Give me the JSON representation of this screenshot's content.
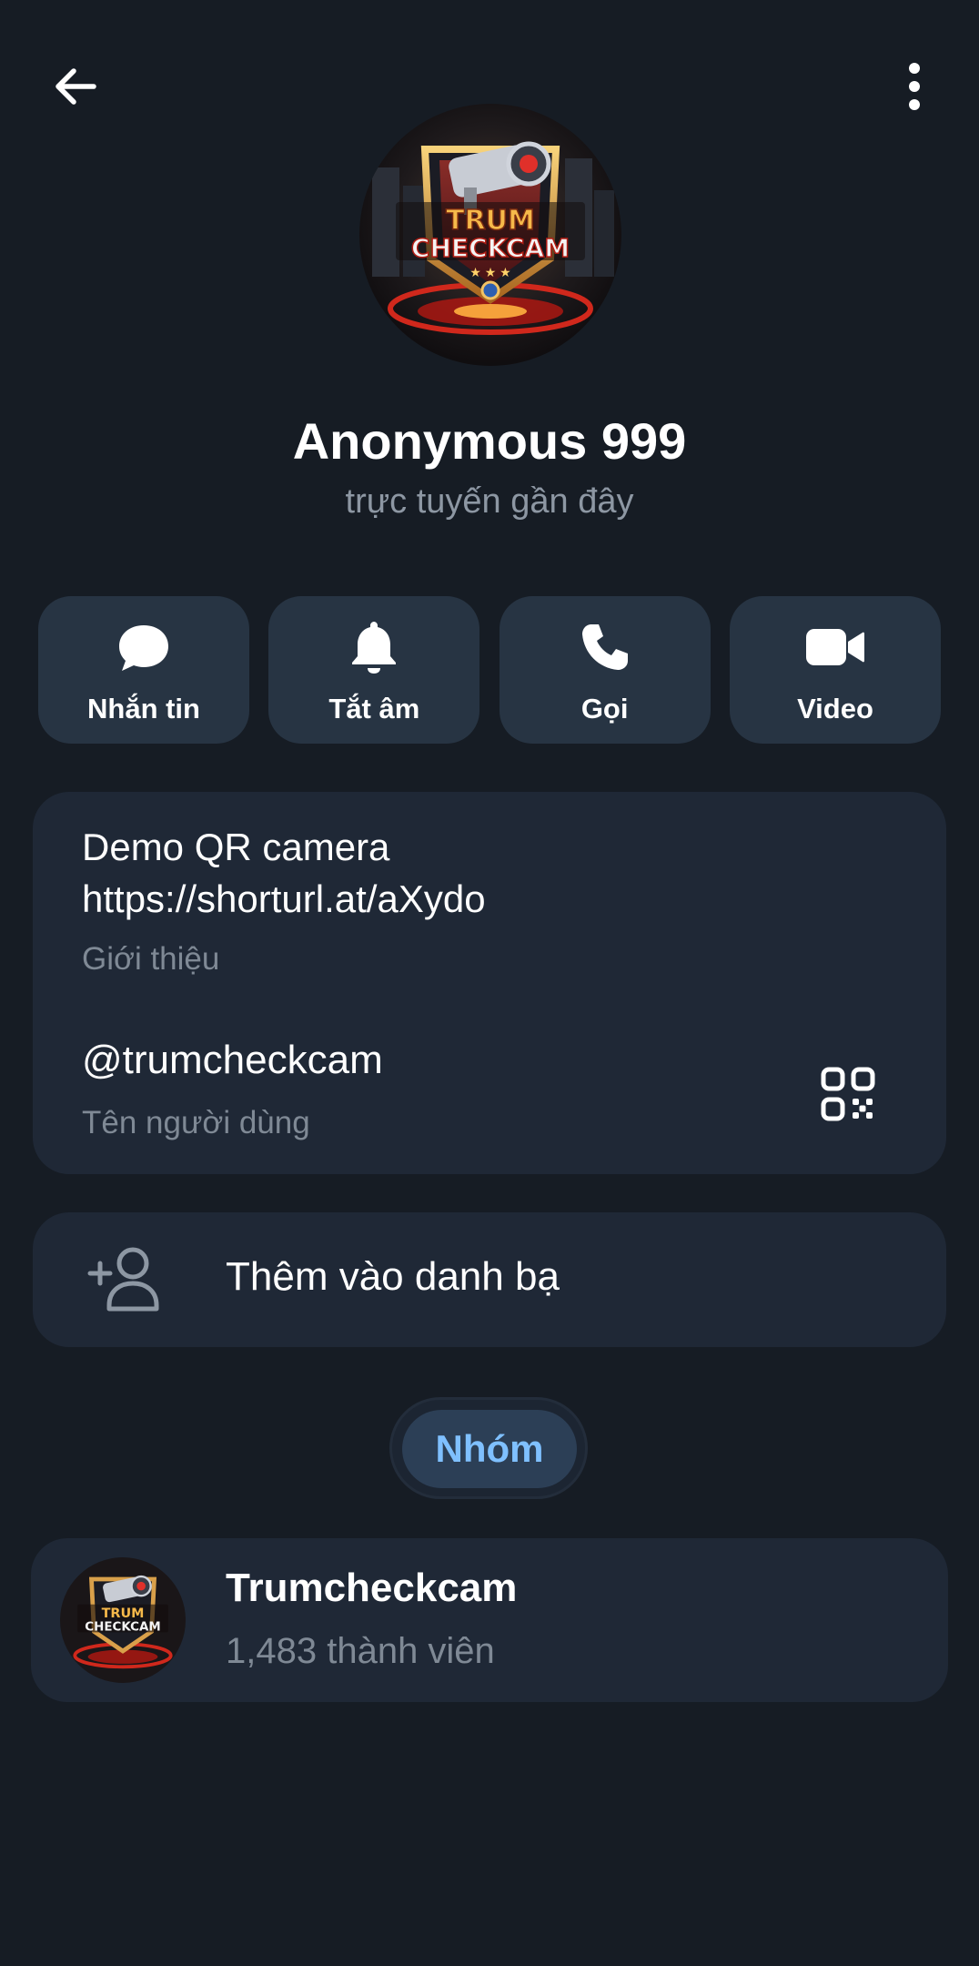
{
  "profile": {
    "name": "Anonymous 999",
    "status": "trực tuyến gần đây",
    "avatar_text_line1": "TRUM",
    "avatar_text_line2": "CHECKCAM"
  },
  "actions": [
    {
      "label": "Nhắn tin",
      "icon": "message-icon"
    },
    {
      "label": "Tắt âm",
      "icon": "bell-icon"
    },
    {
      "label": "Gọi",
      "icon": "phone-icon"
    },
    {
      "label": "Video",
      "icon": "video-camera-icon"
    }
  ],
  "info": {
    "bio_line1": "Demo QR camera",
    "bio_line2": "https://shorturl.at/aXydo",
    "bio_caption": "Giới thiệu",
    "username": "@trumcheckcam",
    "username_caption": "Tên người dùng"
  },
  "add_contact": {
    "label": "Thêm vào danh bạ"
  },
  "groups_tab": {
    "label": "Nhóm"
  },
  "group": {
    "name": "Trumcheckcam",
    "members": "1,483 thành viên"
  },
  "colors": {
    "background": "#161c24",
    "card": "#1f2836",
    "action_button": "#273443",
    "accent": "#7fc0ff",
    "secondary_text": "#7f8995"
  }
}
